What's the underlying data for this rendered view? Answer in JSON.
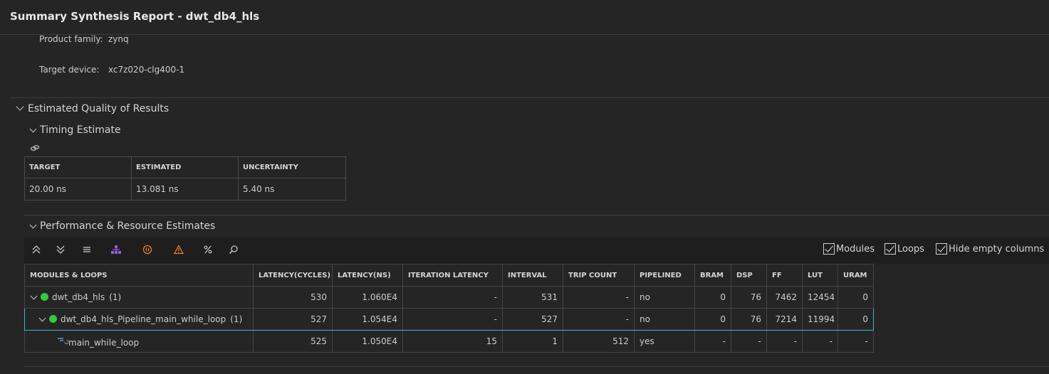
{
  "header": {
    "title": "Summary Synthesis Report - dwt_db4_hls"
  },
  "info": {
    "product_family_label": "Product family:",
    "product_family_value": "zynq",
    "target_device_label": "Target device:",
    "target_device_value": "xc7z020-clg400-1"
  },
  "sections": {
    "qor": "Estimated Quality of Results",
    "timing": "Timing Estimate",
    "perf": "Performance & Resource Estimates"
  },
  "timing_table": {
    "headers": [
      "TARGET",
      "ESTIMATED",
      "UNCERTAINTY"
    ],
    "row": [
      "20.00 ns",
      "13.081 ns",
      "5.40 ns"
    ]
  },
  "toolbar": {
    "icons": [
      "collapse-all-icon",
      "expand-all-icon",
      "list-icon",
      "hierarchy-icon",
      "pause-icon",
      "warning-icon",
      "percent-icon",
      "search-icon"
    ],
    "checkboxes": {
      "modules": "Modules",
      "loops": "Loops",
      "hide_empty": "Hide empty columns"
    }
  },
  "perf_table": {
    "headers": [
      "MODULES & LOOPS",
      "LATENCY(CYCLES)",
      "LATENCY(NS)",
      "ITERATION LATENCY",
      "INTERVAL",
      "TRIP COUNT",
      "PIPELINED",
      "BRAM",
      "DSP",
      "FF",
      "LUT",
      "URAM"
    ],
    "rows": [
      {
        "name": "dwt_db4_hls",
        "count": "(1)",
        "cells": [
          "530",
          "1.060E4",
          "-",
          "531",
          "-",
          "no",
          "0",
          "76",
          "7462",
          "12454",
          "0"
        ]
      },
      {
        "name": "dwt_db4_hls_Pipeline_main_while_loop",
        "count": "(1)",
        "cells": [
          "527",
          "1.054E4",
          "-",
          "527",
          "-",
          "no",
          "0",
          "76",
          "7214",
          "11994",
          "0"
        ]
      },
      {
        "name": "main_while_loop",
        "cells": [
          "525",
          "1.050E4",
          "15",
          "1",
          "512",
          "yes",
          "-",
          "-",
          "-",
          "-",
          "-"
        ]
      }
    ]
  },
  "colors": {
    "background": "#252526",
    "status_ok": "#2ecc40",
    "selected_border": "#3fb6c4",
    "hierarchy_icon": "#9b59d6",
    "pause_icon": "#e67e22",
    "warning_icon": "#e67e22"
  }
}
